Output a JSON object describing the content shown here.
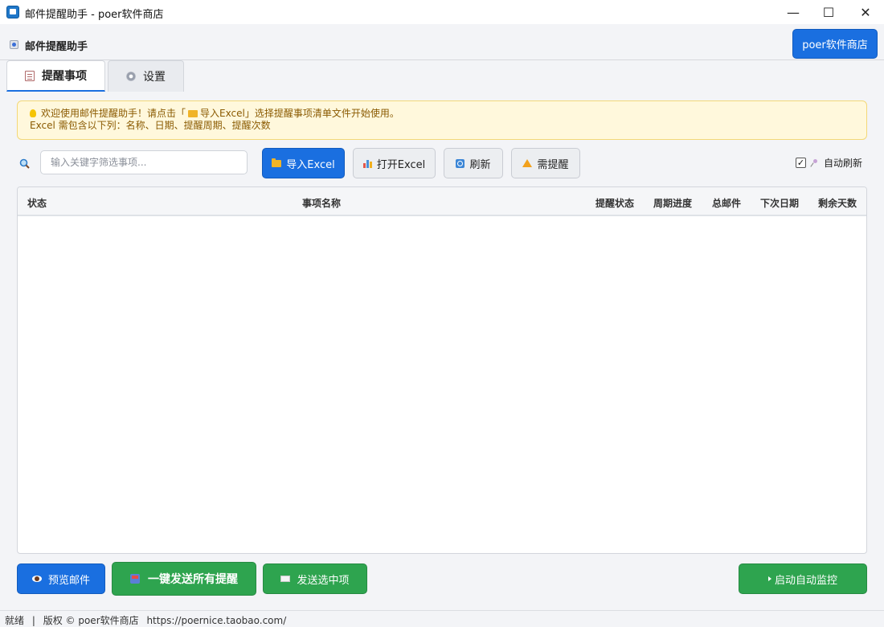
{
  "window": {
    "title": "邮件提醒助手 - poer软件商店",
    "controls": {
      "minimize": "—",
      "maximize": "☐",
      "close": "✕"
    }
  },
  "header": {
    "title": "邮件提醒助手",
    "store_button": "poer软件商店"
  },
  "tabs": [
    {
      "label": "提醒事项",
      "icon": "memo-icon",
      "active": true
    },
    {
      "label": "设置",
      "icon": "gear-icon",
      "active": false
    }
  ],
  "notice": {
    "line1_prefix": "欢迎使用邮件提醒助手！请点击「",
    "line1_highlight": "导入Excel",
    "line1_suffix": "」选择提醒事项清单文件开始使用。",
    "line2": "Excel 需包含以下列：名称、日期、提醒周期、提醒次数"
  },
  "toolbar": {
    "search_placeholder": "输入关键字筛选事项...",
    "import_label": "导入Excel",
    "open_label": "打开Excel",
    "refresh_label": "刷新",
    "remind_label": "需提醒",
    "auto_refresh_label": "自动刷新",
    "auto_refresh_checked": "✓"
  },
  "table": {
    "columns": [
      "状态",
      "事项名称",
      "提醒状态",
      "周期进度",
      "总邮件",
      "下次日期",
      "剩余天数"
    ],
    "rows": []
  },
  "actions": {
    "preview_label": "预览邮件",
    "send_all_label": "一键发送所有提醒",
    "send_selected_label": "发送选中项",
    "start_monitor_label": "启动自动监控"
  },
  "status": {
    "state": "就绪",
    "separator": "|",
    "copyright": "版权 © poer软件商店",
    "url": "https://poernice.taobao.com/"
  },
  "colors": {
    "primary": "#1a6fe0",
    "success": "#2ea44f",
    "notice_bg": "#fff8dc",
    "notice_text": "#8a5a00"
  }
}
